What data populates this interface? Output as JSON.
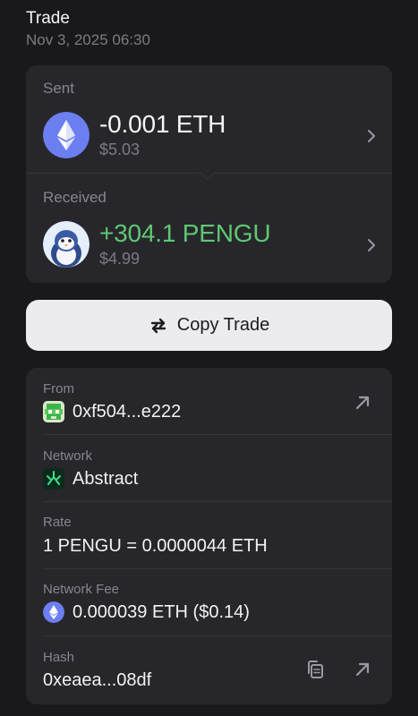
{
  "header": {
    "title": "Trade",
    "date": "Nov 3, 2025 06:30"
  },
  "sent": {
    "label": "Sent",
    "amount": "-0.001 ETH",
    "usd": "$5.03",
    "icon": "ethereum-icon"
  },
  "received": {
    "label": "Received",
    "amount": "+304.1 PENGU",
    "usd": "$4.99",
    "icon": "pengu-token-icon"
  },
  "copy_button": {
    "label": "Copy Trade",
    "icon": "swap-arrows-icon"
  },
  "details": {
    "from": {
      "label": "From",
      "value": "0xf504...e222",
      "icon": "wallet-avatar-icon",
      "action_icon": "external-link-icon"
    },
    "network": {
      "label": "Network",
      "value": "Abstract",
      "icon": "abstract-network-icon"
    },
    "rate": {
      "label": "Rate",
      "value": "1 PENGU = 0.0000044 ETH"
    },
    "fee": {
      "label": "Network Fee",
      "value": "0.000039 ETH ($0.14)",
      "icon": "ethereum-icon"
    },
    "hash": {
      "label": "Hash",
      "value": "0xeaea...08df",
      "copy_icon": "copy-icon",
      "action_icon": "external-link-icon"
    }
  },
  "colors": {
    "background": "#19191b",
    "card": "#27272b",
    "positive": "#5fc773",
    "muted": "#85858c",
    "eth": "#6b7ff0"
  }
}
